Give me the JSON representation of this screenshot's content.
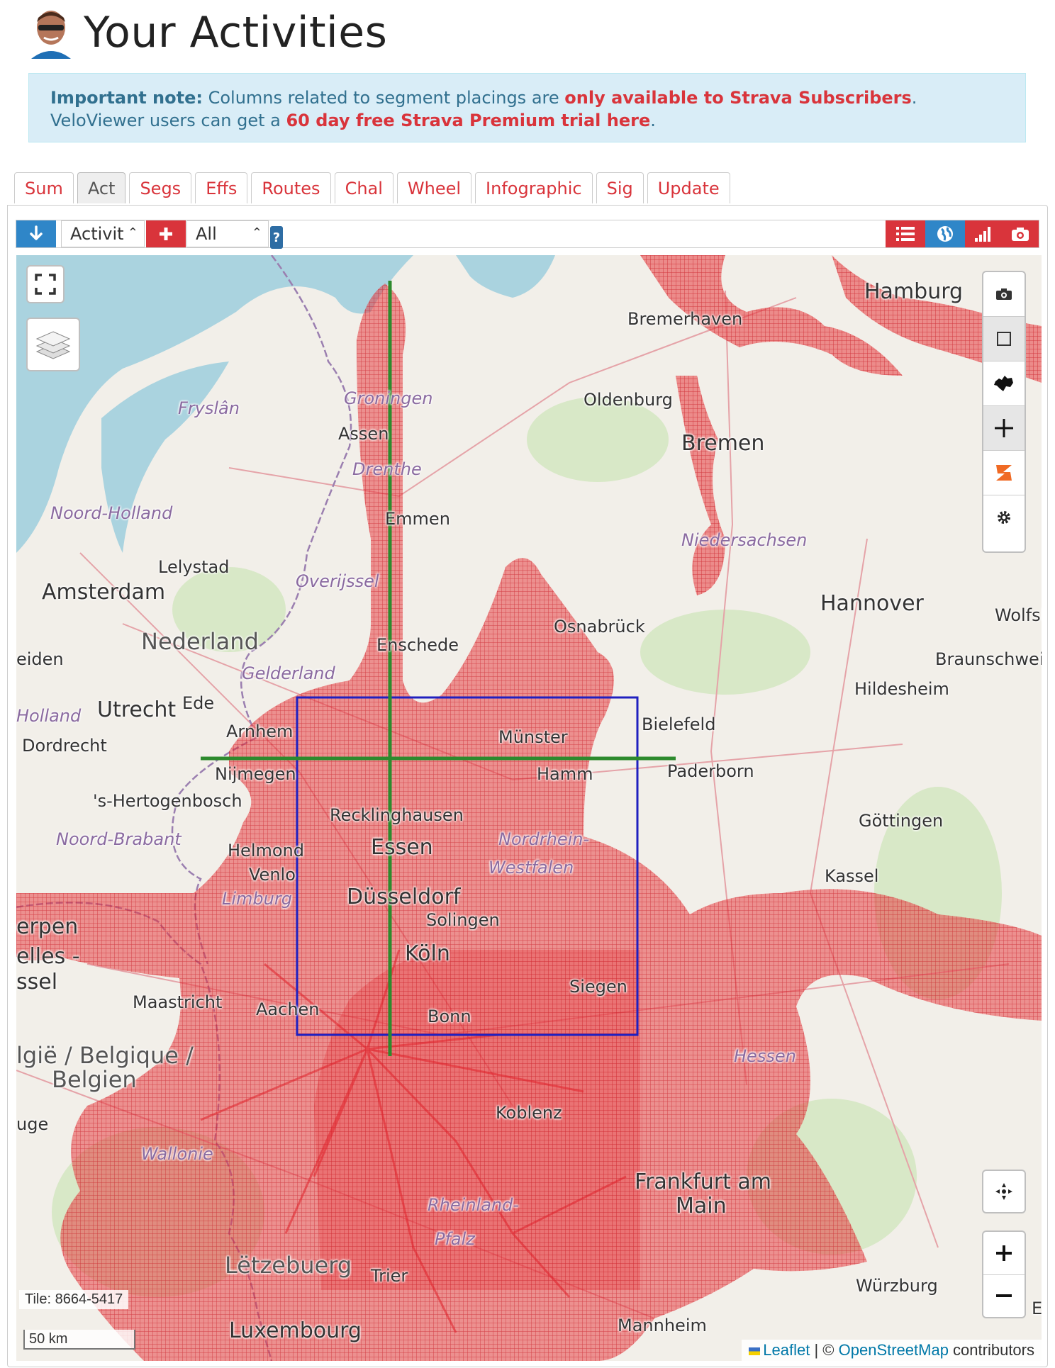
{
  "header": {
    "title": "Your Activities",
    "avatar_icon": "user-avatar"
  },
  "notice": {
    "lead": "Important note:",
    "text1": " Columns related to segment placings are ",
    "link1": "only available to Strava Subscribers",
    "text2": ". VeloViewer users can get a ",
    "link2": "60 day free Strava Premium trial here",
    "text3": "."
  },
  "tabs": [
    {
      "label": "Sum",
      "active": false
    },
    {
      "label": "Act",
      "active": true
    },
    {
      "label": "Segs",
      "active": false
    },
    {
      "label": "Effs",
      "active": false
    },
    {
      "label": "Routes",
      "active": false
    },
    {
      "label": "Chal",
      "active": false
    },
    {
      "label": "Wheel",
      "active": false
    },
    {
      "label": "Infographic",
      "active": false
    },
    {
      "label": "Sig",
      "active": false
    },
    {
      "label": "Update",
      "active": false
    }
  ],
  "toolbar": {
    "activity_select": "Activit",
    "filter_select": "All",
    "help": "?"
  },
  "map": {
    "places": [
      {
        "name": "Hamburg",
        "style": "big"
      },
      {
        "name": "Bremerhaven",
        "style": "city"
      },
      {
        "name": "Groningen",
        "style": "region"
      },
      {
        "name": "Fryslân",
        "style": "region"
      },
      {
        "name": "Oldenburg",
        "style": "city"
      },
      {
        "name": "Bremen",
        "style": "big"
      },
      {
        "name": "Assen",
        "style": "city"
      },
      {
        "name": "Drenthe",
        "style": "region"
      },
      {
        "name": "Emmen",
        "style": "city"
      },
      {
        "name": "Noord-Holland",
        "style": "region"
      },
      {
        "name": "Niedersachsen",
        "style": "region"
      },
      {
        "name": "Lelystad",
        "style": "city"
      },
      {
        "name": "Overijssel",
        "style": "region"
      },
      {
        "name": "Amsterdam",
        "style": "big"
      },
      {
        "name": "Hannover",
        "style": "big"
      },
      {
        "name": "Osnabrück",
        "style": "city"
      },
      {
        "name": "Wolfsl",
        "style": "city"
      },
      {
        "name": "Nederland",
        "style": "country"
      },
      {
        "name": "Enschede",
        "style": "city"
      },
      {
        "name": "eiden",
        "style": "city"
      },
      {
        "name": "Braunschwei",
        "style": "city"
      },
      {
        "name": "Gelderland",
        "style": "region"
      },
      {
        "name": "Hildesheim",
        "style": "city"
      },
      {
        "name": "Utrecht",
        "style": "big"
      },
      {
        "name": "Ede",
        "style": "city"
      },
      {
        "name": "Bielefeld",
        "style": "city"
      },
      {
        "name": "Holland",
        "style": "region"
      },
      {
        "name": "Arnhem",
        "style": "city"
      },
      {
        "name": "Münster",
        "style": "city"
      },
      {
        "name": "Dordrecht",
        "style": "city"
      },
      {
        "name": "Nijmegen",
        "style": "city"
      },
      {
        "name": "Paderborn",
        "style": "city"
      },
      {
        "name": "Hamm",
        "style": "city"
      },
      {
        "name": "'s-Hertogenbosch",
        "style": "city"
      },
      {
        "name": "Recklinghausen",
        "style": "city"
      },
      {
        "name": "Göttingen",
        "style": "city"
      },
      {
        "name": "Noord-Brabant",
        "style": "region"
      },
      {
        "name": "Helmond",
        "style": "city"
      },
      {
        "name": "Essen",
        "style": "big"
      },
      {
        "name": "Nordrhein-",
        "style": "region"
      },
      {
        "name": "Westfalen",
        "style": "region"
      },
      {
        "name": "Kassel",
        "style": "city"
      },
      {
        "name": "Venlo",
        "style": "city"
      },
      {
        "name": "Limburg",
        "style": "region"
      },
      {
        "name": "Düsseldorf",
        "style": "big"
      },
      {
        "name": "erpen",
        "style": "big"
      },
      {
        "name": "Solingen",
        "style": "city"
      },
      {
        "name": "elles -",
        "style": "big"
      },
      {
        "name": "Köln",
        "style": "big"
      },
      {
        "name": "ssel",
        "style": "big"
      },
      {
        "name": "Siegen",
        "style": "city"
      },
      {
        "name": "Maastricht",
        "style": "city"
      },
      {
        "name": "Aachen",
        "style": "city"
      },
      {
        "name": "Bonn",
        "style": "city"
      },
      {
        "name": "lgië / Belgique /",
        "style": "country"
      },
      {
        "name": "Hessen",
        "style": "region"
      },
      {
        "name": "Belgien",
        "style": "country"
      },
      {
        "name": "Koblenz",
        "style": "city"
      },
      {
        "name": "uge",
        "style": "city"
      },
      {
        "name": "Wallonie",
        "style": "region"
      },
      {
        "name": "Frankfurt am",
        "style": "big"
      },
      {
        "name": "Rheinland-",
        "style": "region"
      },
      {
        "name": "Main",
        "style": "big"
      },
      {
        "name": "Pfalz",
        "style": "region"
      },
      {
        "name": "Lëtzebuerg",
        "style": "country"
      },
      {
        "name": "Trier",
        "style": "city"
      },
      {
        "name": "Würzburg",
        "style": "city"
      },
      {
        "name": "Luxembourg",
        "style": "big"
      },
      {
        "name": "Mannheim",
        "style": "city"
      },
      {
        "name": "E",
        "style": "city"
      }
    ],
    "tile_info": "Tile: 8664-5417",
    "scale": "50 km",
    "attribution": {
      "leaflet": "Leaflet",
      "sep": " | © ",
      "osm": "OpenStreetMap",
      "suffix": " contributors"
    },
    "colors": {
      "heat": "#e8383d",
      "grid_line": "#2d8a2d",
      "square": "#2020c0",
      "water": "#aad3df",
      "land": "#f2efe9"
    }
  }
}
